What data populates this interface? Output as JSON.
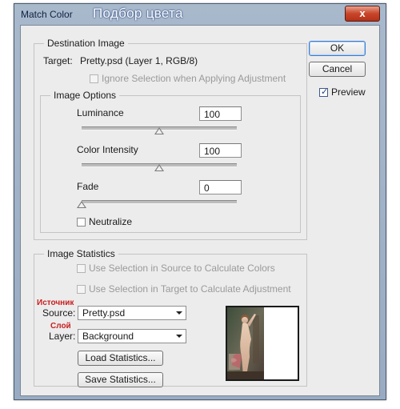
{
  "window": {
    "title": "Match Color",
    "title_annotation": "Подбор цвета",
    "close_label": "x"
  },
  "destination": {
    "group_title": "Destination Image",
    "target_label": "Target:",
    "target_value": "Pretty.psd (Layer 1, RGB/8)",
    "ignore_selection_label": "Ignore Selection when Applying Adjustment",
    "ignore_selection_checked": false
  },
  "image_options": {
    "group_title": "Image Options",
    "luminance_label": "Luminance",
    "luminance_value": "100",
    "luminance_slider_fraction": 0.5,
    "color_intensity_label": "Color Intensity",
    "color_intensity_value": "100",
    "color_intensity_slider_fraction": 0.5,
    "fade_label": "Fade",
    "fade_value": "0",
    "fade_slider_fraction": 0.0,
    "neutralize_label": "Neutralize",
    "neutralize_checked": false
  },
  "statistics": {
    "group_title": "Image Statistics",
    "use_sel_source_label": "Use Selection in Source to Calculate Colors",
    "use_sel_target_label": "Use Selection in Target to Calculate Adjustment",
    "source_label": "Source:",
    "source_value": "Pretty.psd",
    "source_note": "Источник",
    "layer_label": "Layer:",
    "layer_value": "Background",
    "layer_note": "Слой",
    "load_label": "Load Statistics...",
    "save_label": "Save Statistics..."
  },
  "actions": {
    "ok_label": "OK",
    "cancel_label": "Cancel",
    "preview_label": "Preview",
    "preview_checked": true
  },
  "colors": {
    "annotation_red": "#c81f1f",
    "title_bar": "#a9b9cc",
    "dialog_bg": "#ececec"
  }
}
